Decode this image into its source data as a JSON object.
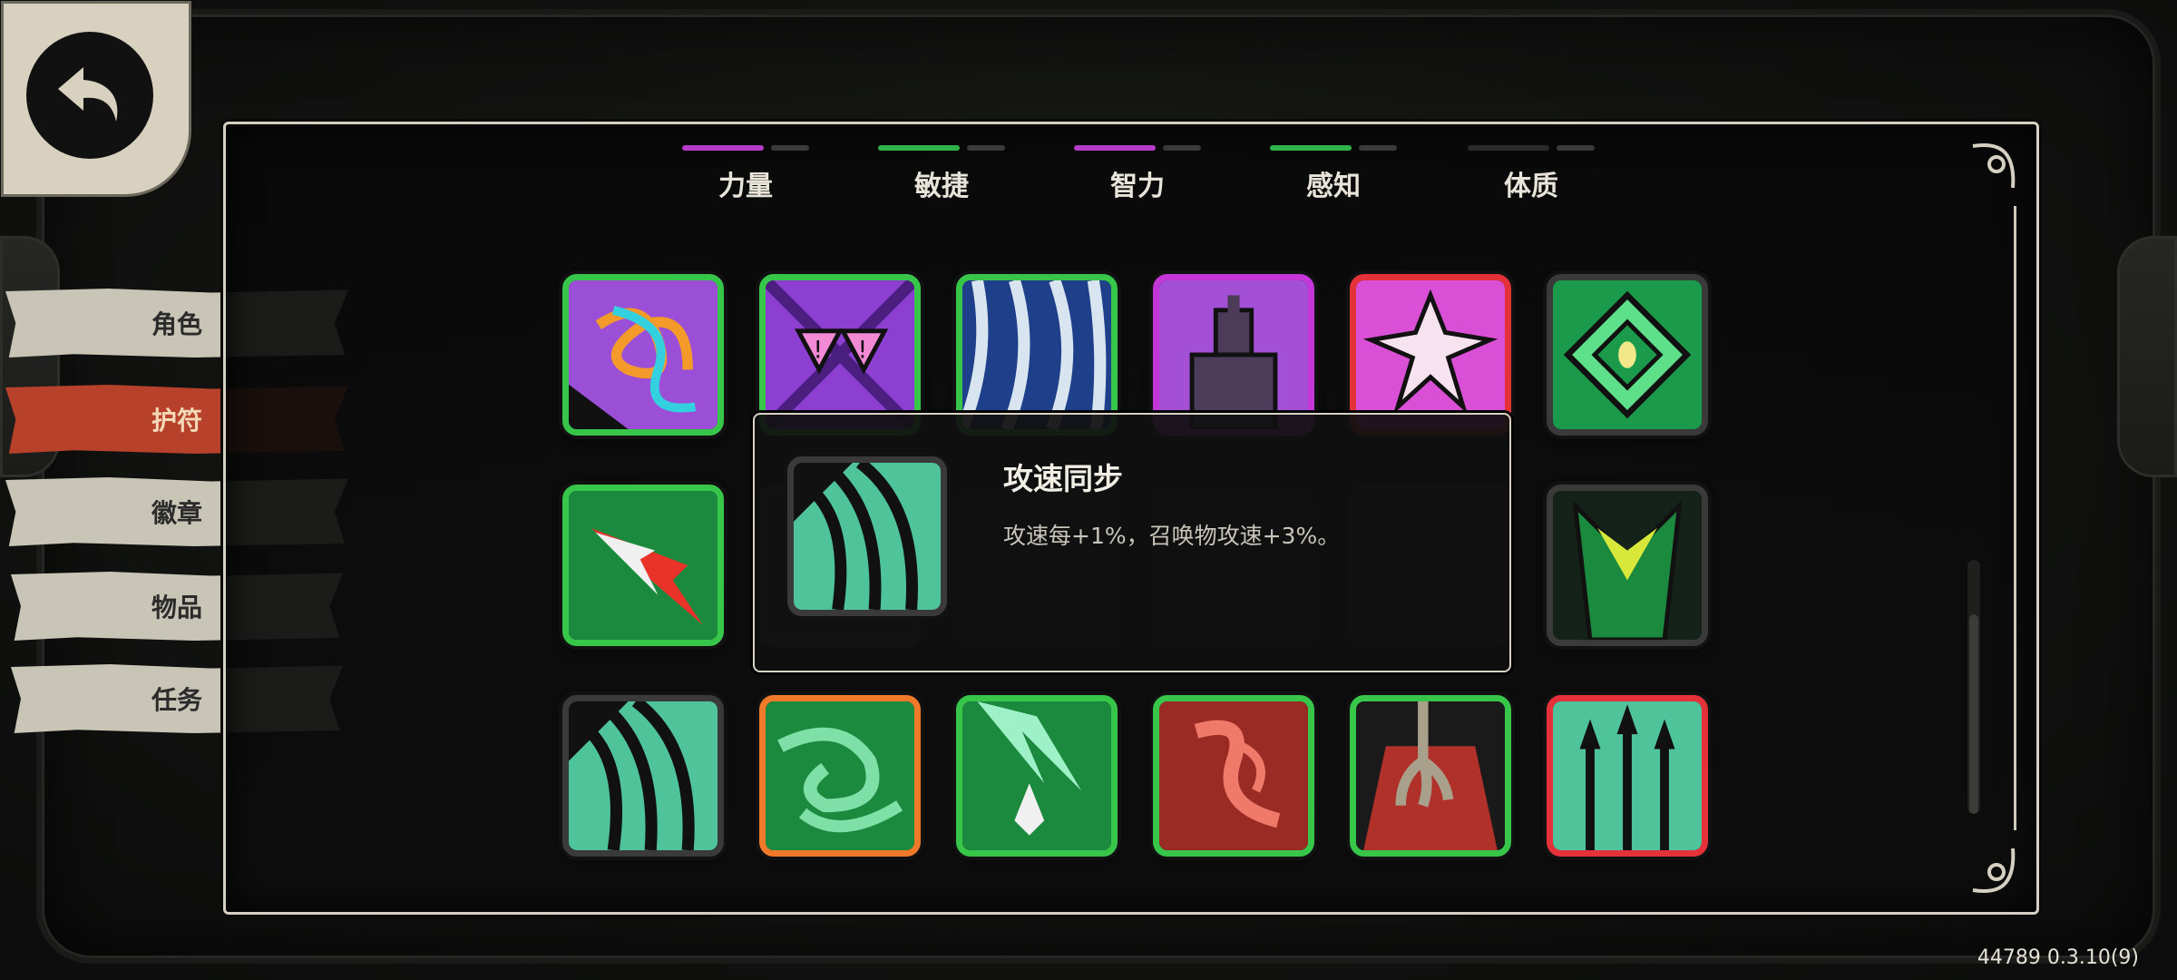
{
  "menu": {
    "items": [
      {
        "label": "角色",
        "active": false
      },
      {
        "label": "护符",
        "active": true
      },
      {
        "label": "徽章",
        "active": false
      },
      {
        "label": "物品",
        "active": false
      },
      {
        "label": "任务",
        "active": false
      }
    ]
  },
  "stats": [
    {
      "label": "力量",
      "color": "#b43cc8"
    },
    {
      "label": "敏捷",
      "color": "#2fb24a"
    },
    {
      "label": "智力",
      "color": "#b43cc8"
    },
    {
      "label": "感知",
      "color": "#2fb24a"
    },
    {
      "label": "体质",
      "color": "#555555"
    }
  ],
  "tooltip": {
    "title": "攻速同步",
    "description": "攻速每+1%，召唤物攻速+3%。"
  },
  "version": "44789 0.3.10(9)",
  "rarity_colors": {
    "green": "#37c64a",
    "purple": "#c436d8",
    "red": "#e5323a",
    "gray": "#3a3a3a",
    "orange": "#f07a2a"
  }
}
